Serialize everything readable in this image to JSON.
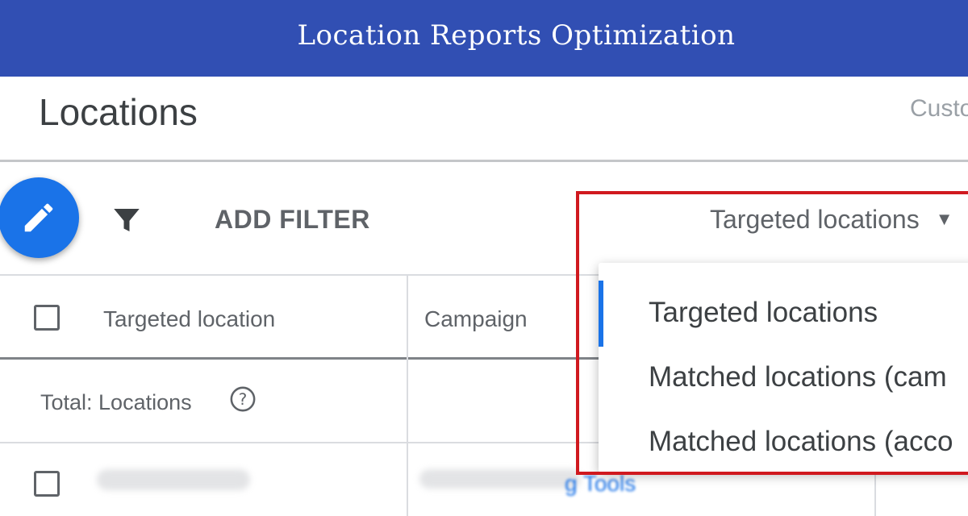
{
  "banner": {
    "title": "Location Reports Optimization"
  },
  "page": {
    "title": "Locations",
    "custom_label": "Custo"
  },
  "toolbar": {
    "add_filter_label": "ADD FILTER",
    "view_select_value": "Targeted locations",
    "view_select_caret": "▼"
  },
  "table": {
    "columns": [
      "Targeted location",
      "Campaign"
    ],
    "total_label": "Total: Locations",
    "partial_text": "g Tools"
  },
  "dropdown": {
    "options": [
      "Targeted locations",
      "Matched locations (cam",
      "Matched locations (acco"
    ],
    "selected_index": 0
  },
  "colors": {
    "banner": "#314fb3",
    "accent": "#1a73e8",
    "highlight": "#d0191f"
  },
  "icons": {
    "fab": "pencil-icon",
    "filter": "filter-icon",
    "help": "help-circle-icon"
  }
}
